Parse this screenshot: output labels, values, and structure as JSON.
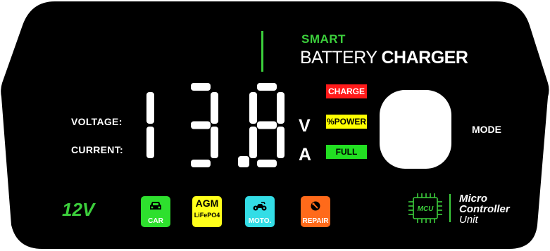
{
  "brand": {
    "smart": "SMART",
    "battery": "BATTERY",
    "charger": "CHARGER"
  },
  "display": {
    "voltage_label": "VOLTAGE:",
    "current_label": "CURRENT:",
    "reading": "13.8",
    "unit_v": "V",
    "unit_a": "A",
    "segment_color": "#ffffff"
  },
  "status": {
    "charge": {
      "label": "CHARGE",
      "color": "#ff1a1a"
    },
    "power": {
      "label": "%POWER",
      "color": "#ffff00"
    },
    "full": {
      "label": "FULL",
      "color": "#22e022"
    }
  },
  "mode": {
    "label": "MODE"
  },
  "voltage_select": "12V",
  "modes": [
    {
      "label": "CAR",
      "color": "#2ee02e",
      "icon": "car-icon"
    },
    {
      "label": "AGM",
      "sublabel": "LiFePO4",
      "color": "#ffff1a"
    },
    {
      "label": "MOTO.",
      "color": "#33dde6",
      "icon": "motorcycle-icon"
    },
    {
      "label": "REPAIR",
      "color": "#ff6a1a",
      "icon": "repair-icon"
    }
  ],
  "mcu": {
    "chip_label": "MCU",
    "line1": "Micro",
    "line2": "Controller",
    "line3": "Unit",
    "color": "#3ccf3c"
  }
}
